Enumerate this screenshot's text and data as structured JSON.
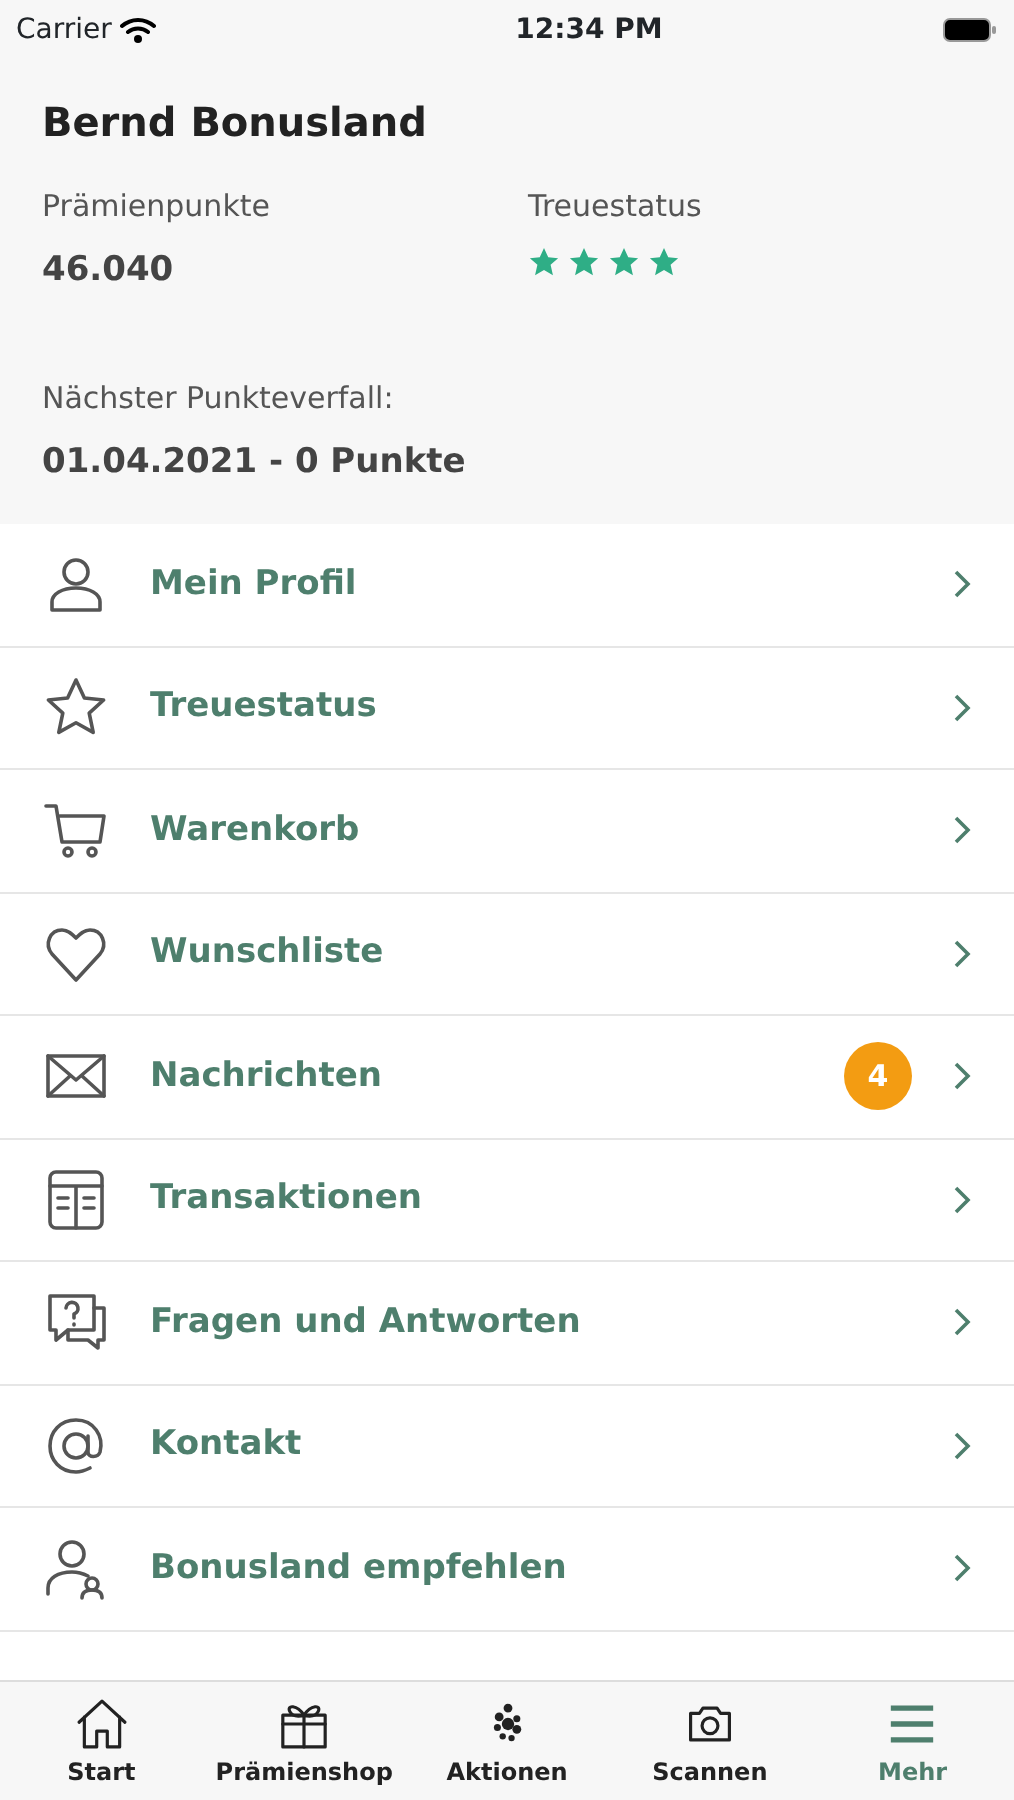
{
  "status_bar": {
    "carrier": "Carrier",
    "time": "12:34 PM"
  },
  "profile": {
    "name": "Bernd Bonusland",
    "points_label": "Prämienpunkte",
    "points": "46.040",
    "status_label": "Treuestatus",
    "stars": 4,
    "expiry_label": "Nächster Punkteverfall:",
    "expiry": "01.04.2021 - 0 Punkte"
  },
  "menu": [
    {
      "label": "Mein Profil"
    },
    {
      "label": "Treuestatus"
    },
    {
      "label": "Warenkorb"
    },
    {
      "label": "Wunschliste"
    },
    {
      "label": "Nachrichten",
      "badge": "4"
    },
    {
      "label": "Transaktionen"
    },
    {
      "label": "Fragen und Antworten"
    },
    {
      "label": "Kontakt"
    },
    {
      "label": "Bonusland empfehlen"
    }
  ],
  "tab_bar": [
    {
      "label": "Start",
      "selected": false
    },
    {
      "label": "Prämienshop",
      "selected": false
    },
    {
      "label": "Aktionen",
      "selected": false
    },
    {
      "label": "Scannen",
      "selected": false
    },
    {
      "label": "Mehr",
      "selected": true
    }
  ]
}
